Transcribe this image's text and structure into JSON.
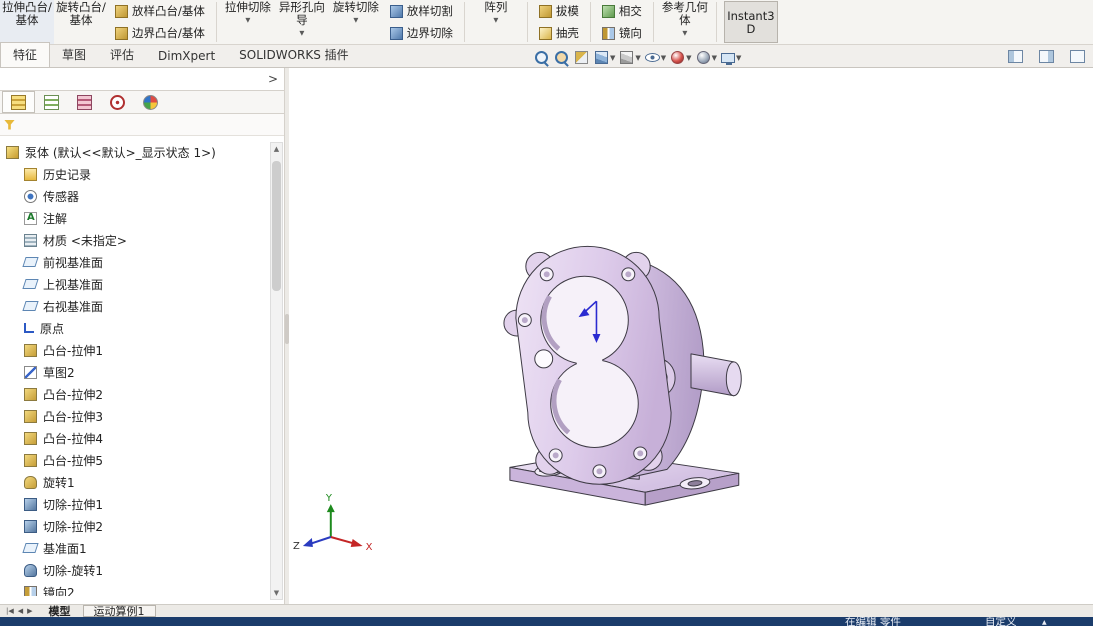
{
  "ribbon": {
    "items": [
      {
        "type": "large",
        "label": "拉伸凸台/基体",
        "icon": "boss-extrude",
        "arrow": false
      },
      {
        "type": "large",
        "label": "旋转凸台/基体",
        "icon": "revolved-boss",
        "arrow": false
      },
      {
        "type": "small",
        "label": "放样凸台/基体",
        "icon": "lofted-boss"
      },
      {
        "type": "small",
        "label": "边界凸台/基体",
        "icon": "boundary-boss"
      },
      {
        "type": "sep"
      },
      {
        "type": "large",
        "label": "拉伸切除",
        "icon": "extruded-cut",
        "arrow": true
      },
      {
        "type": "large",
        "label": "异形孔向导",
        "icon": "hole-wizard",
        "arrow": true
      },
      {
        "type": "large",
        "label": "旋转切除",
        "icon": "revolved-cut",
        "arrow": true
      },
      {
        "type": "small",
        "label": "放样切割",
        "icon": "lofted-cut"
      },
      {
        "type": "small",
        "label": "边界切除",
        "icon": "boundary-cut"
      },
      {
        "type": "sep"
      },
      {
        "type": "large",
        "label": "阵列",
        "icon": "linear-pattern",
        "arrow": true
      },
      {
        "type": "sep"
      },
      {
        "type": "small",
        "label": "拔模",
        "icon": "draft"
      },
      {
        "type": "small",
        "label": "抽壳",
        "icon": "shell"
      },
      {
        "type": "sep"
      },
      {
        "type": "small",
        "label": "相交",
        "icon": "intersect"
      },
      {
        "type": "small",
        "label": "镜向",
        "icon": "mirror"
      },
      {
        "type": "sep"
      },
      {
        "type": "large",
        "label": "参考几何体",
        "icon": "reference-geometry",
        "arrow": true
      },
      {
        "type": "sep"
      },
      {
        "type": "large",
        "label": "Instant3D",
        "icon": "instant3d",
        "arrow": false,
        "pressed": true
      }
    ]
  },
  "tabs": [
    {
      "label": "特征",
      "state": "active"
    },
    {
      "label": "草图",
      "state": ""
    },
    {
      "label": "评估",
      "state": ""
    },
    {
      "label": "DimXpert",
      "state": ""
    },
    {
      "label": "SOLIDWORKS 插件",
      "state": ""
    }
  ],
  "view_toolbar": [
    {
      "icon": "zoom-to-fit",
      "arrow": false
    },
    {
      "icon": "zoom-to-area",
      "arrow": false
    },
    {
      "icon": "section-view",
      "arrow": false
    },
    {
      "icon": "view-orientation",
      "arrow": true
    },
    {
      "icon": "display-style",
      "arrow": true
    },
    {
      "icon": "hide-show-items",
      "arrow": true
    },
    {
      "icon": "edit-appearance",
      "arrow": true
    },
    {
      "icon": "apply-scene",
      "arrow": true
    },
    {
      "icon": "view-settings",
      "arrow": true
    }
  ],
  "window_icons": [
    {
      "icon": "pane-left"
    },
    {
      "icon": "pane-right"
    },
    {
      "icon": "collapse-ribbon"
    }
  ],
  "panel": {
    "tabs": [
      {
        "icon": "featuremanager",
        "state": "active"
      },
      {
        "icon": "propertymanager",
        "state": ""
      },
      {
        "icon": "configurationmanager",
        "state": ""
      },
      {
        "icon": "dimxpertmanager",
        "state": ""
      },
      {
        "icon": "displaymanager",
        "state": ""
      }
    ],
    "expand_label": ">",
    "tree": {
      "root": {
        "label": "泵体 (默认<<默认>_显示状态 1>)",
        "icon": "part"
      },
      "items": [
        {
          "label": "历史记录",
          "icon": "history"
        },
        {
          "label": "传感器",
          "icon": "sensors"
        },
        {
          "label": "注解",
          "icon": "annotations"
        },
        {
          "label": "材质 <未指定>",
          "icon": "material"
        },
        {
          "label": "前视基准面",
          "icon": "plane"
        },
        {
          "label": "上视基准面",
          "icon": "plane"
        },
        {
          "label": "右视基准面",
          "icon": "plane"
        },
        {
          "label": "原点",
          "icon": "origin"
        },
        {
          "label": "凸台-拉伸1",
          "icon": "boss-extrude"
        },
        {
          "label": "草图2",
          "icon": "sketch"
        },
        {
          "label": "凸台-拉伸2",
          "icon": "boss-extrude"
        },
        {
          "label": "凸台-拉伸3",
          "icon": "boss-extrude"
        },
        {
          "label": "凸台-拉伸4",
          "icon": "boss-extrude"
        },
        {
          "label": "凸台-拉伸5",
          "icon": "boss-extrude"
        },
        {
          "label": "旋转1",
          "icon": "revolve"
        },
        {
          "label": "切除-拉伸1",
          "icon": "cut-extrude"
        },
        {
          "label": "切除-拉伸2",
          "icon": "cut-extrude"
        },
        {
          "label": "基准面1",
          "icon": "plane"
        },
        {
          "label": "切除-旋转1",
          "icon": "cut-revolve"
        },
        {
          "label": "镜向2",
          "icon": "mirror"
        }
      ]
    }
  },
  "viewport": {
    "model_name": "泵体",
    "triad": {
      "x_label": "X",
      "y_label": "Y",
      "z_label": "Z"
    },
    "colors": {
      "model": "#dcc8e8",
      "model_dark": "#b49fc9",
      "model_light": "#eee3f5",
      "edge": "#3d3a44"
    }
  },
  "bottom_bar": {
    "nav": [
      {
        "name": "first-study",
        "glyph": "|◀"
      },
      {
        "name": "previous-study",
        "glyph": "◀"
      },
      {
        "name": "next-study",
        "glyph": "▶"
      }
    ],
    "tabs": [
      {
        "label": "模型",
        "state": "active"
      },
      {
        "label": "运动算例1",
        "state": ""
      }
    ]
  },
  "status_bar": {
    "editing": "在编辑 零件",
    "custom": "自定义"
  }
}
